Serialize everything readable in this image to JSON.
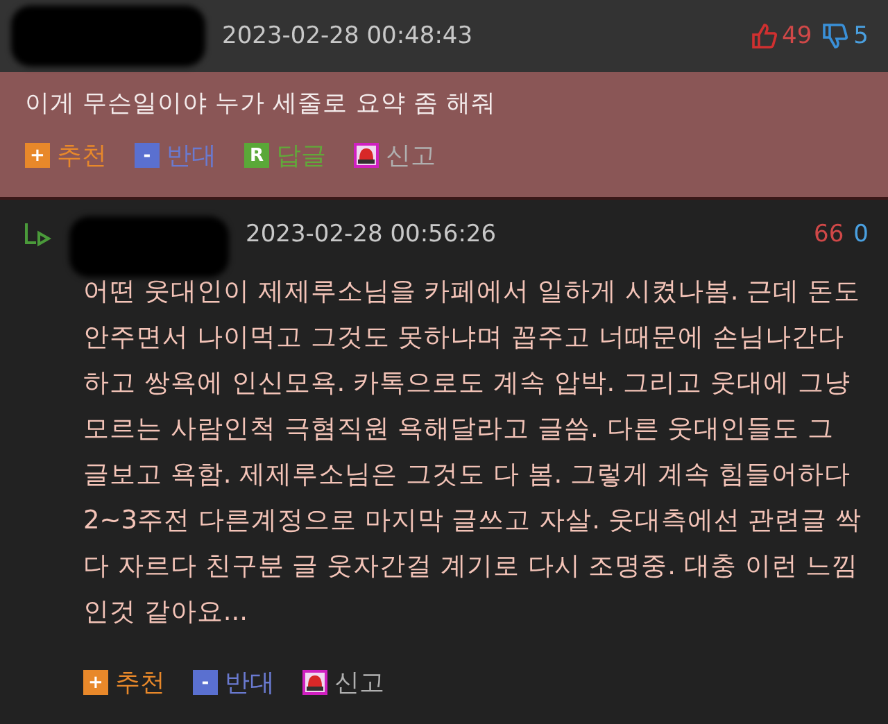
{
  "comments": [
    {
      "kind": "best",
      "reply": false,
      "timestamp": "2023-02-28 00:48:43",
      "votes": {
        "icons": true,
        "up": "49",
        "down": "5"
      },
      "text": "이게 무슨일이야 누가 세줄로 요약 좀 해줘",
      "actions": [
        {
          "kind": "up",
          "icon": "+",
          "label": "추천"
        },
        {
          "kind": "down",
          "icon": "-",
          "label": "반대"
        },
        {
          "kind": "reply",
          "icon": "R",
          "label": "답글"
        },
        {
          "kind": "report",
          "label": "신고"
        }
      ]
    },
    {
      "kind": "normal",
      "reply": true,
      "timestamp": "2023-02-28 00:56:26",
      "votes": {
        "icons": false,
        "up": "66",
        "down": "0"
      },
      "text": "어떤 웃대인이 제제루소님을 카페에서 일하게 시켰나봄. 근데 돈도 안주면서 나이먹고 그것도 못하냐며 꼽주고 너때문에 손님나간다하고 쌍욕에 인신모욕. 카톡으로도 계속 압박. 그리고 웃대에 그냥 모르는 사람인척 극혐직원 욕해달라고 글씀. 다른 웃대인들도 그 글보고 욕함. 제제루소님은 그것도 다 봄. 그렇게 계속 힘들어하다 2~3주전 다른계정으로 마지막 글쓰고 자살. 웃대측에선 관련글 싹다 자르다 친구분 글 웃자간걸 계기로 다시 조명중. 대충 이런 느낌인것 같아요...",
      "actions": [
        {
          "kind": "up",
          "icon": "+",
          "label": "추천"
        },
        {
          "kind": "down",
          "icon": "-",
          "label": "반대"
        },
        {
          "kind": "report",
          "label": "신고"
        }
      ]
    }
  ]
}
